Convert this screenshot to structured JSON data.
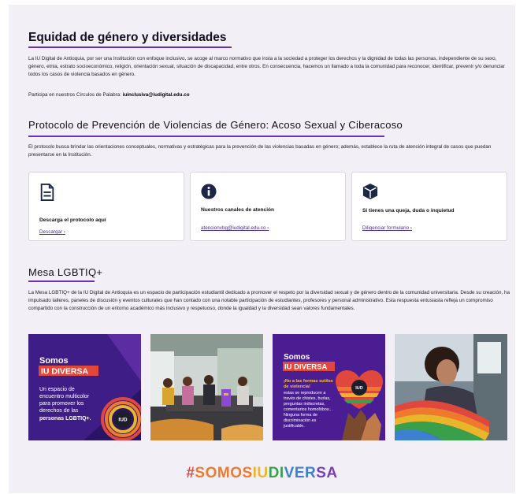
{
  "header": {
    "title": "Equidad de género y diversidades",
    "intro": "La IU Digital de Antioquia, por ser una Institución con enfoque inclusivo, se acoge al marco normativo que insta a la sociedad a proteger los derechos y la dignidad de todas las personas, independiente de su sexo, género, etnia, estrato socioeconómico, religión, orientación sexual, situación de discapacidad, entre otros. En consecuencia, hacemos un llamado a toda la comunidad para reconocer, identificar, prevenir y/o denunciar todos los casos de violencia basados en género.",
    "circles_prefix": "Participa en nuestros Círculos de Palabra:",
    "circles_email": "iuinclusiva@iudigital.edu.co"
  },
  "protocol": {
    "title": "Protocolo de Prevención de Violencias de Género: Acoso Sexual y Ciberacoso",
    "description": "El protocolo busca brindar las orientaciones conceptuales, normativas y estratégicas para la prevención de las violencias basadas en género; además, establece la ruta de atención integral de casos que puedan presentarse en la Institución.",
    "cards": [
      {
        "icon": "document-icon",
        "title": "Descarga el protocolo aquí",
        "link": "Descargar ›"
      },
      {
        "icon": "info-icon",
        "title": "Nuestros canales de atención",
        "link": "atencionvbg@iudigital.edu.co ›"
      },
      {
        "icon": "cube-icon",
        "title": "Si tienes una queja, duda o inquietud",
        "link": "Diligenciar formulario ›"
      }
    ]
  },
  "mesa": {
    "title": "Mesa LGBTIQ+",
    "description": "La Mesa LGBTIQ+ de la IU Digital de Antioquia es un espacio de participación estudiantil dedicado a promover el respeto por la diversidad sexual y de género dentro de la comunidad universitaria. Desde su creación, ha impulsado talleres, paneles de discusión y eventos culturales que han contado con una notable participación de estudiantes, profesores y personal administrativo. Esta respuesta entusiasta refleja un compromiso compartido con la construcción de un entorno académico más inclusivo y respetuoso, donde la igualdad y la diversidad sean valores fundamentales."
  },
  "gallery": {
    "poster1": {
      "line1": "Somos",
      "line2": "IU DIVERSA",
      "body": [
        "Un espacio de",
        "encuentro multicolor",
        "para promover los",
        "derechos de las"
      ],
      "strong": "personas LGBTIQ+."
    },
    "poster2": {
      "line1": "Somos",
      "line2": "IU DIVERSA",
      "lead": [
        "¡No a las formas sutiles",
        "de violencia!"
      ],
      "body": [
        "estas se reproducen a",
        "través de chistes, burlas,",
        "preguntas indiscretas,",
        "comentarios homofóbos...",
        "Ninguna forma de",
        "discriminación es",
        "justificable."
      ]
    },
    "badge": "IUD"
  },
  "footer": {
    "hashtag_parts": [
      {
        "text": "#",
        "color": "#e0483e"
      },
      {
        "text": "SOMOS",
        "color": "#ef7a2e"
      },
      {
        "text": "IU",
        "color": "#e9b52a"
      },
      {
        "text": "DI",
        "color": "#3a9f4a"
      },
      {
        "text": "VER",
        "color": "#3d7fd0"
      },
      {
        "text": "SA",
        "color": "#7a3fb8"
      }
    ]
  },
  "colors": {
    "accent": "#6a32b3",
    "poster_bg": "#3e1d86",
    "link": "#4a2f8c"
  }
}
